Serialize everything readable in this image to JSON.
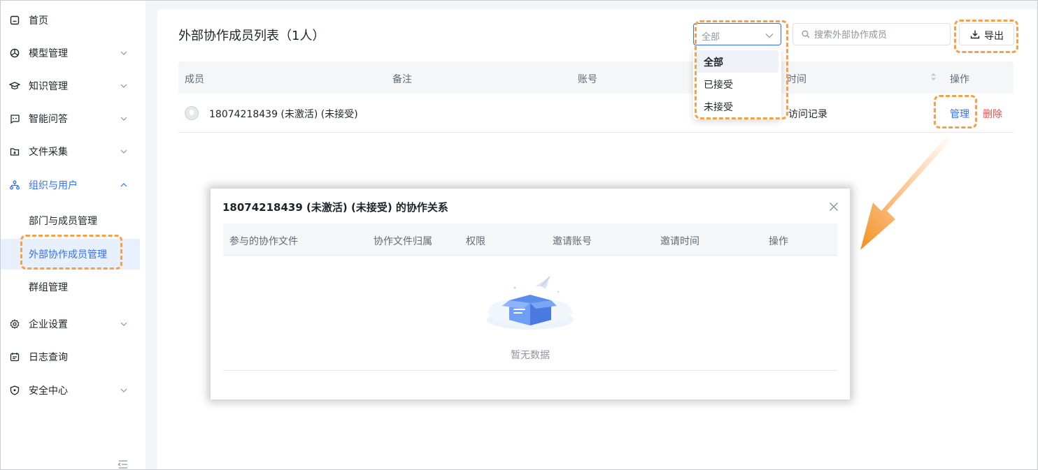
{
  "sidebar": {
    "items": [
      {
        "label": "首页",
        "icon": "home-icon"
      },
      {
        "label": "模型管理",
        "icon": "model-icon"
      },
      {
        "label": "知识管理",
        "icon": "knowledge-icon"
      },
      {
        "label": "智能问答",
        "icon": "chat-icon"
      },
      {
        "label": "文件采集",
        "icon": "file-collect-icon"
      },
      {
        "label": "组织与用户",
        "icon": "org-icon"
      },
      {
        "label": "企业设置",
        "icon": "settings-icon"
      },
      {
        "label": "日志查询",
        "icon": "log-icon"
      },
      {
        "label": "安全中心",
        "icon": "shield-icon"
      }
    ],
    "sub_items": [
      {
        "label": "部门与成员管理"
      },
      {
        "label": "外部协作成员管理",
        "active": true
      },
      {
        "label": "群组管理"
      }
    ]
  },
  "page": {
    "title": "外部协作成员列表（1人）"
  },
  "filter": {
    "selected": "全部",
    "options": [
      "全部",
      "已接受",
      "未接受"
    ]
  },
  "search": {
    "placeholder": "搜索外部协作成员"
  },
  "export": {
    "label": "导出"
  },
  "table": {
    "columns": [
      "成员",
      "备注",
      "账号",
      "时间",
      "操作"
    ],
    "rows": [
      {
        "member": "18074218439 (未激活) (未接受)",
        "visit": "访问记录",
        "manage": "管理",
        "delete": "删除"
      }
    ]
  },
  "modal": {
    "title": "18074218439 (未激活) (未接受) 的协作关系",
    "columns": [
      "参与的协作文件",
      "协作文件归属",
      "权限",
      "邀请账号",
      "邀请时间",
      "操作"
    ],
    "empty_text": "暂无数据"
  },
  "colors": {
    "accent": "#3370ff",
    "danger": "#f54a45",
    "highlight": "#f5a04a"
  }
}
